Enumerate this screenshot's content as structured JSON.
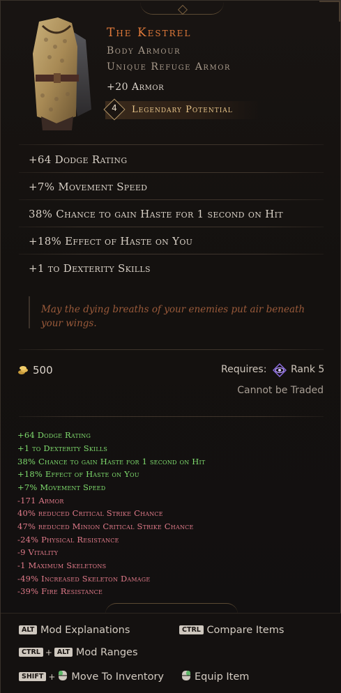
{
  "item": {
    "name": "The Kestrel",
    "base_type": "Body Armour",
    "subtype": "Unique Refuge Armor",
    "implicit": "+20 Armor",
    "legendary_potential": {
      "value": "4",
      "label": "Legendary Potential"
    }
  },
  "affixes": [
    "+64 Dodge Rating",
    "+7% Movement Speed",
    "38% Chance to gain Haste for 1 second on Hit",
    "+18% Effect of Haste on You",
    "+1 to Dexterity Skills"
  ],
  "lore": "May the dying breaths of your enemies put air beneath your wings.",
  "footer": {
    "price": "500",
    "requires_label": "Requires:",
    "rank": "Rank 5",
    "trade_status": "Cannot be Traded"
  },
  "comparison": [
    {
      "text": "+64 Dodge Rating",
      "kind": "positive"
    },
    {
      "text": "+1 to Dexterity Skills",
      "kind": "positive"
    },
    {
      "text": "38% Chance to gain Haste for 1 second on Hit",
      "kind": "positive"
    },
    {
      "text": "+18% Effect of Haste on You",
      "kind": "positive"
    },
    {
      "text": "+7% Movement Speed",
      "kind": "positive"
    },
    {
      "text": "-171 Armor",
      "kind": "negative"
    },
    {
      "text": "40% reduced Critical Strike Chance",
      "kind": "negative"
    },
    {
      "text": "47% reduced Minion Critical Strike Chance",
      "kind": "negative"
    },
    {
      "text": "-24% Physical Resistance",
      "kind": "negative"
    },
    {
      "text": "-9 Vitality",
      "kind": "negative"
    },
    {
      "text": "-1 Maximum Skeletons",
      "kind": "negative"
    },
    {
      "text": "-49% Increased Skeleton Damage",
      "kind": "negative"
    },
    {
      "text": "-39% Fire Resistance",
      "kind": "negative"
    }
  ],
  "hints": {
    "mod_explanations": {
      "key": "ALT",
      "label": "Mod Explanations"
    },
    "compare_items": {
      "key": "CTRL",
      "label": "Compare Items"
    },
    "mod_ranges": {
      "key1": "CTRL",
      "key2": "ALT",
      "label": "Mod Ranges"
    },
    "move_to_inventory": {
      "key": "SHIFT",
      "label": "Move To Inventory"
    },
    "equip_item": {
      "label": "Equip Item"
    }
  },
  "colors": {
    "title": "#e17a3a",
    "positive": "#7fdc6e",
    "negative": "#e07a8a",
    "lore": "#9a5a3a",
    "legendary": "#e8c58a"
  },
  "icons": [
    "armor-art-icon",
    "gold-coin-icon",
    "rank-eye-icon",
    "mouse-button-icon"
  ]
}
